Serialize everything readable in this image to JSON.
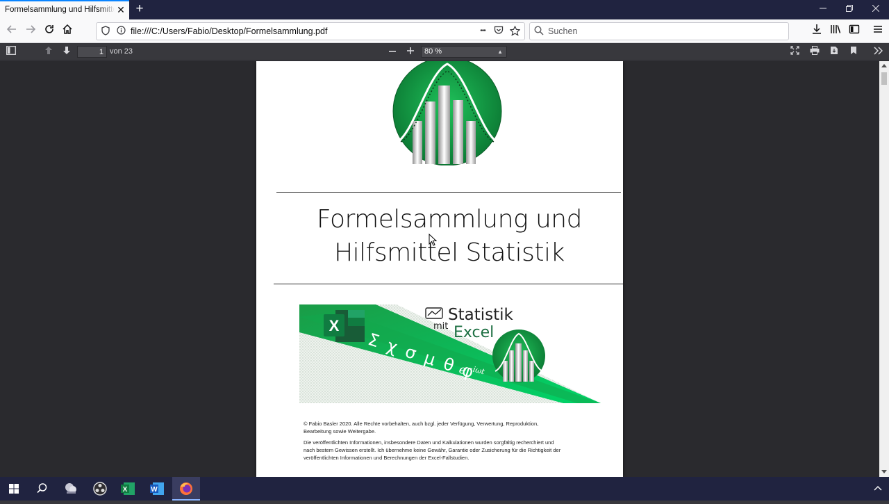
{
  "browser": {
    "tab_title": "Formelsammlung und Hilfsmittel Statistik",
    "tab_close": "✕",
    "new_tab": "+",
    "url": "file:///C:/Users/Fabio/Desktop/Formelsammlung.pdf",
    "search_placeholder": "Suchen",
    "page_actions": "•••"
  },
  "pdf_toolbar": {
    "current_page": "1",
    "page_count": "von 23",
    "zoom": "80 %"
  },
  "document": {
    "title_line1": "Formelsammlung und",
    "title_line2": "Hilfsmittel Statistik",
    "banner": {
      "brand_top": "Statistik",
      "brand_mit": "mit",
      "brand_excel": "Excel",
      "symbols": "Σ χ σ μ θ φ",
      "exponent": "e",
      "exponent_sup": "−iωt"
    },
    "legal_1": "© Fabio Basler 2020. Alle Rechte vorbehalten, auch bzgl. jeder Verfügung, Verwertung, Reproduktion, Bearbeitung sowie Weitergabe.",
    "legal_2": "Die veröffentlichten Informationen, insbesondere Daten und Kalkulationen wurden sorgfältig recherchiert und nach bestem Gewissen erstellt. Ich übernehme keine Gewähr, Garantie oder Zusicherung für die Richtigkeit der veröffentlichten Informationen und Berechnungen der Excel-Fallstudien."
  },
  "colors": {
    "accent_green": "#1fa34a",
    "bright_green": "#00d468",
    "excel_green": "#1d6f42",
    "firefox_blue": "#0a84ff",
    "taskbar": "#202340"
  }
}
